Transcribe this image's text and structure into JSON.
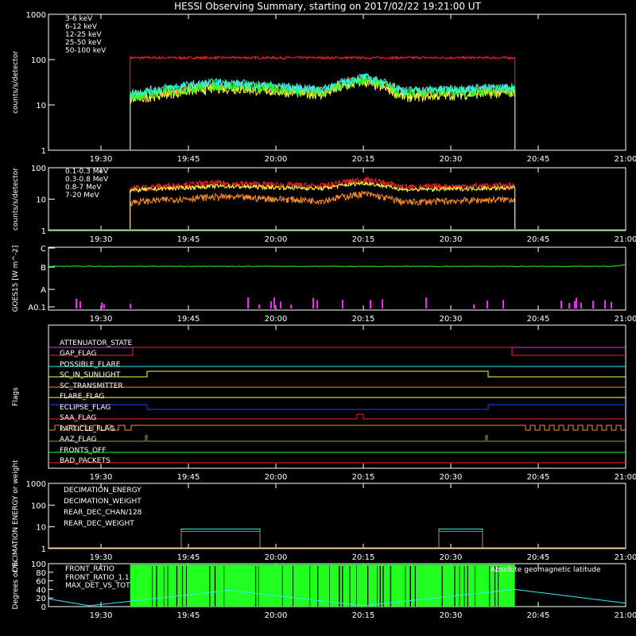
{
  "title": "HESSI Observing Summary, starting on 2017/02/22 19:21:00 UT",
  "time_ticks": [
    "19:30",
    "19:45",
    "20:00",
    "20:15",
    "20:30",
    "20:45",
    "21:00"
  ],
  "colors": {
    "red": "#ff2020",
    "orange": "#ff8c20",
    "yellow": "#ffff30",
    "green": "#20ff20",
    "cyan": "#30f0f0",
    "magenta": "#ff20ff",
    "white": "#ffffff",
    "blue": "#2040ff",
    "olive": "#a09a40"
  },
  "chart_data": [
    {
      "type": "line",
      "panel": "count-rates-low",
      "ylabel": "counts/s/detector",
      "yscale": "log",
      "ylim": [
        1,
        1000
      ],
      "y_ticks": [
        "1",
        "10",
        "100",
        "1000"
      ],
      "x_range": [
        "19:21",
        "21:00"
      ],
      "data_window": [
        "19:35",
        "20:41"
      ],
      "series": [
        {
          "name": "3-6 keV",
          "color": "#ff2020",
          "x": [
            "19:35",
            "20:15",
            "20:41"
          ],
          "y": [
            110,
            110,
            110
          ]
        },
        {
          "name": "6-12 keV",
          "color": "#ff8c20",
          "x": [
            "19:35",
            "19:50",
            "20:08",
            "20:15",
            "20:22",
            "20:41"
          ],
          "y": [
            15,
            28,
            20,
            38,
            18,
            22
          ]
        },
        {
          "name": "12-25 keV",
          "color": "#ffff30",
          "x": [
            "19:35",
            "19:50",
            "20:08",
            "20:15",
            "20:22",
            "20:41"
          ],
          "y": [
            13,
            24,
            17,
            33,
            15,
            19
          ]
        },
        {
          "name": "25-50 keV",
          "color": "#20ff20",
          "x": [
            "19:35",
            "19:50",
            "20:08",
            "20:15",
            "20:22",
            "20:41"
          ],
          "y": [
            16,
            28,
            20,
            38,
            19,
            22
          ]
        },
        {
          "name": "50-100 keV",
          "color": "#30f0f0",
          "x": [
            "19:35",
            "19:50",
            "20:08",
            "20:15",
            "20:22",
            "20:41"
          ],
          "y": [
            18,
            32,
            22,
            42,
            21,
            25
          ]
        }
      ]
    },
    {
      "type": "line",
      "panel": "count-rates-high",
      "ylabel": "counts/s/detector",
      "yscale": "log",
      "ylim": [
        1,
        100
      ],
      "y_ticks": [
        "1",
        "10",
        "100"
      ],
      "data_window": [
        "19:35",
        "20:41"
      ],
      "series": [
        {
          "name": "0.1-0.3 MeV",
          "color": "#ff2020",
          "x": [
            "19:35",
            "19:50",
            "20:08",
            "20:15",
            "20:22",
            "20:41"
          ],
          "y": [
            22,
            32,
            26,
            42,
            24,
            27
          ]
        },
        {
          "name": "0.3-0.8 MeV",
          "color": "#ff8c20",
          "x": [
            "19:35",
            "19:50",
            "20:08",
            "20:15",
            "20:22",
            "20:41"
          ],
          "y": [
            8,
            12,
            9,
            15,
            8,
            10
          ]
        },
        {
          "name": "0.8-7 MeV",
          "color": "#ffff30",
          "x": [
            "19:35",
            "19:50",
            "20:08",
            "20:15",
            "20:22",
            "20:41"
          ],
          "y": [
            19,
            26,
            22,
            33,
            20,
            23
          ]
        },
        {
          "name": "7-20 MeV",
          "color": "#20ff20",
          "x": [
            "19:21",
            "21:00"
          ],
          "y": [
            1,
            1
          ]
        }
      ]
    },
    {
      "type": "line",
      "panel": "goes",
      "ylabel": "GOES15 [W m^-2]",
      "y_ticks": [
        "A0.1",
        "A",
        "B",
        "C"
      ],
      "series": [
        {
          "name": "GOES15",
          "color": "#20ff20",
          "x": [
            "19:21",
            "20:55",
            "21:00"
          ],
          "y_class": [
            "B",
            "B",
            "B"
          ]
        }
      ]
    },
    {
      "type": "table",
      "panel": "flags",
      "ylabel": "Flags",
      "flags": [
        {
          "name": "ATTENUATOR_STATE",
          "color": "#ff20ff"
        },
        {
          "name": "GAP_FLAG",
          "color": "#ff2020"
        },
        {
          "name": "POSSIBLE_FLARE",
          "color": "#30f0f0"
        },
        {
          "name": "SC_IN_SUNLIGHT",
          "color": "#ffff30"
        },
        {
          "name": "SC_TRANSMITTER",
          "color": "#ff8c20"
        },
        {
          "name": "FLARE_FLAG",
          "color": "#ffff30"
        },
        {
          "name": "ECLIPSE_FLAG",
          "color": "#2040ff"
        },
        {
          "name": "SAA_FLAG",
          "color": "#ff2020"
        },
        {
          "name": "PARTICLE_FLAG",
          "color": "#ff8c20"
        },
        {
          "name": "AAZ_FLAG",
          "color": "#a09a40"
        },
        {
          "name": "FRONTS_OFF",
          "color": "#20ff20"
        },
        {
          "name": "BAD_PACKETS",
          "color": "#ff2020"
        }
      ]
    },
    {
      "type": "line",
      "panel": "decimation",
      "ylabel": "DECIMATION ENERGY or weight",
      "yscale": "log",
      "ylim": [
        1,
        1000
      ],
      "y_ticks": [
        "1",
        "10",
        "100",
        "1000"
      ],
      "series": [
        {
          "name": "DECIMATION_ENERGY",
          "color": "#20ff20"
        },
        {
          "name": "DECIMATION_WEIGHT",
          "color": "#ff8c20"
        },
        {
          "name": "REAR_DEC_CHAN/128",
          "color": "#30f0f0"
        },
        {
          "name": "REAR_DEC_WEIGHT",
          "color": "#a09a40"
        }
      ]
    },
    {
      "type": "line",
      "panel": "ratios",
      "ylabel": "Degrees or %",
      "ylim": [
        0,
        100
      ],
      "y_ticks": [
        "0",
        "20",
        "40",
        "60",
        "80",
        "100"
      ],
      "series": [
        {
          "name": "FRONT_RATIO",
          "color": "#20ff20"
        },
        {
          "name": "FRONT_RATIO_1.1",
          "color": "#ffff30"
        },
        {
          "name": "MAX_DET_VS_TOT",
          "color": "#ff8c20"
        },
        {
          "name": "Absolute geomagnetic latitude",
          "color": "#30f0f0",
          "x": [
            "19:21",
            "19:28",
            "19:52",
            "20:15",
            "20:41",
            "21:00"
          ],
          "y": [
            18,
            2,
            38,
            2,
            40,
            8
          ]
        }
      ]
    }
  ]
}
